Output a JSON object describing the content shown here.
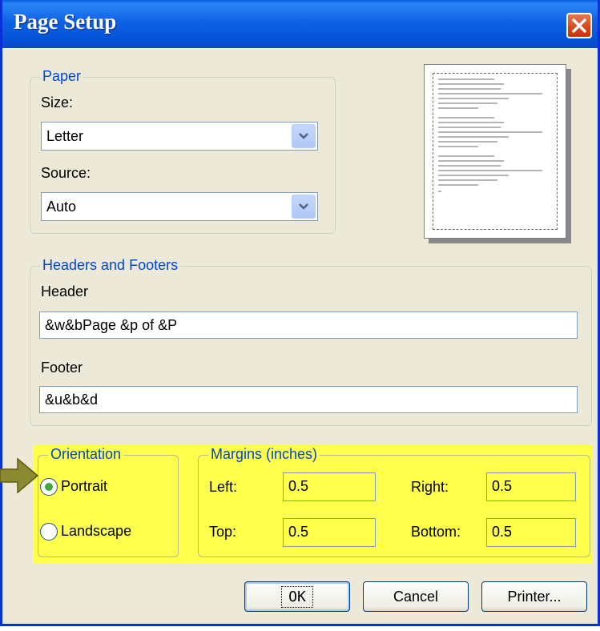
{
  "window": {
    "title": "Page Setup"
  },
  "paper": {
    "legend": "Paper",
    "size_label": "Size:",
    "size_value": "Letter",
    "source_label": "Source:",
    "source_value": "Auto"
  },
  "headers_footers": {
    "legend": "Headers and Footers",
    "header_label": "Header",
    "header_value": "&w&bPage &p of &P",
    "footer_label": "Footer",
    "footer_value": "&u&b&d"
  },
  "orientation": {
    "legend": "Orientation",
    "portrait_label": "Portrait",
    "landscape_label": "Landscape",
    "selected": "Portrait"
  },
  "margins": {
    "legend": "Margins (inches)",
    "left_label": "Left:",
    "left_value": "0.5",
    "right_label": "Right:",
    "right_value": "0.5",
    "top_label": "Top:",
    "top_value": "0.5",
    "bottom_label": "Bottom:",
    "bottom_value": "0.5"
  },
  "buttons": {
    "ok": "OK",
    "cancel": "Cancel",
    "printer": "Printer..."
  },
  "colors": {
    "highlight": "#ffff4d",
    "title_bar": "#0352d6",
    "pointer_arrow": "#8c8a30"
  }
}
